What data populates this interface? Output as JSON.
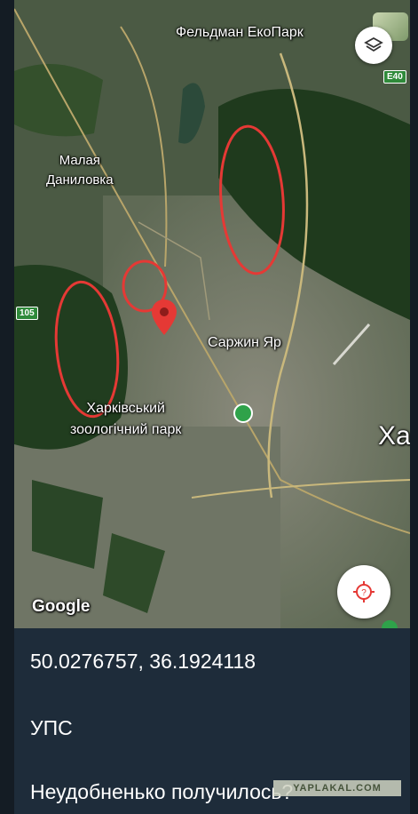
{
  "map": {
    "labels": {
      "feldman": "Фельдман ЕкоПарк",
      "malaya_line1": "Малая",
      "malaya_line2": "Даниловка",
      "sarzhyn": "Саржин Яр",
      "zoo_line1": "Харківський",
      "zoo_line2": "зоологічний парк",
      "city_partial": "Ха"
    },
    "road_badges": {
      "e40": "E40",
      "r105": "105"
    },
    "attribution": "Google",
    "icons": {
      "layers": "layers-icon",
      "locate": "locate-icon",
      "pin": "map-pin-icon",
      "zoo": "zoo-paw-icon"
    },
    "colors": {
      "pin": "#e53935",
      "circle_annotation": "#e53935",
      "badge_green": "#2f8a3a"
    }
  },
  "message": {
    "coordinates": "50.0276757, 36.1924118",
    "line2": "УПС",
    "line3": "Неудобненько получилось?"
  },
  "watermark": "YAPLAKAL.COM"
}
